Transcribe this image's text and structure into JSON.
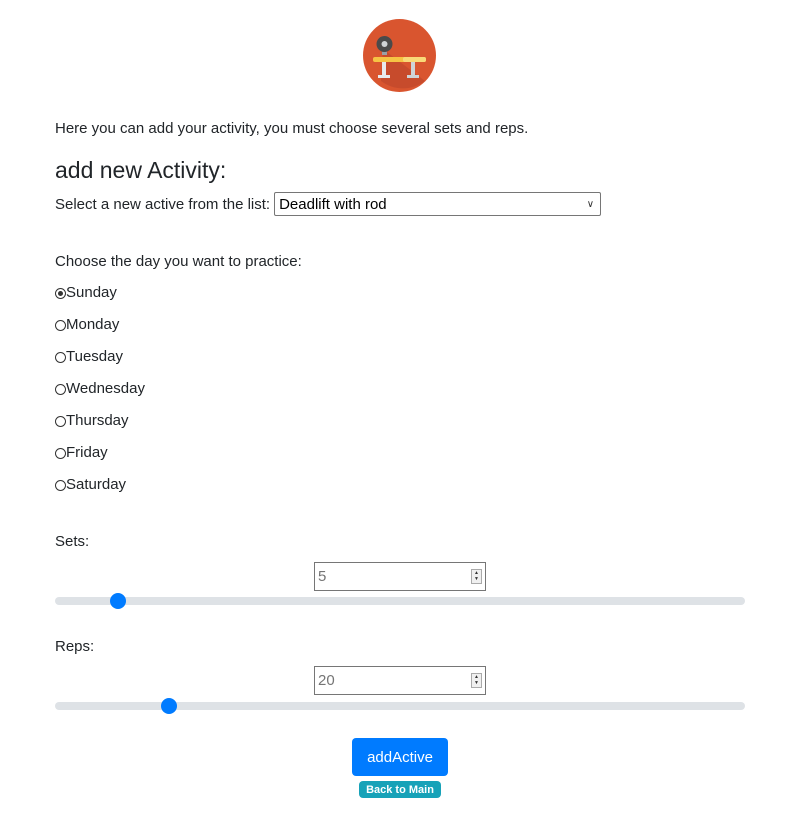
{
  "logo_icon": "workout-bench-icon",
  "intro_text": "Here you can add your activity, you must choose several sets and reps.",
  "heading": "add new Activity:",
  "select": {
    "label": "Select a new active from the list:",
    "value": "Deadlift with rod"
  },
  "day_prompt": "Choose the day you want to practice:",
  "days": [
    {
      "label": "Sunday",
      "checked": true
    },
    {
      "label": "Monday",
      "checked": false
    },
    {
      "label": "Tuesday",
      "checked": false
    },
    {
      "label": "Wednesday",
      "checked": false
    },
    {
      "label": "Thursday",
      "checked": false
    },
    {
      "label": "Friday",
      "checked": false
    },
    {
      "label": "Saturday",
      "checked": false
    }
  ],
  "sets": {
    "label": "Sets:",
    "value": "5",
    "slider_fraction": 0.091
  },
  "reps": {
    "label": "Reps:",
    "value": "20",
    "slider_fraction": 0.165
  },
  "add_button": "addActive",
  "back_link": "Back to Main",
  "colors": {
    "primary": "#007bff",
    "badge": "#17a2b8",
    "logo": "#d9552f"
  }
}
